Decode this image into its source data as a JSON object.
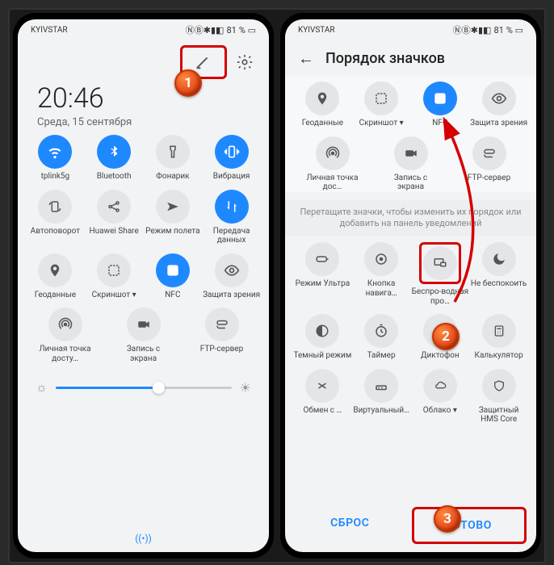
{
  "status": {
    "carrier": "KYIVSTAR",
    "battery": "81"
  },
  "left": {
    "time": "20:46",
    "date": "Среда, 15 сентября",
    "tiles": [
      [
        {
          "icon": "wifi",
          "label": "tplink5g",
          "on": true
        },
        {
          "icon": "bt",
          "label": "Bluetooth",
          "on": true
        },
        {
          "icon": "torch",
          "label": "Фонарик"
        },
        {
          "icon": "vib",
          "label": "Вибрация",
          "on": true
        }
      ],
      [
        {
          "icon": "rotate",
          "label": "Автоповорот"
        },
        {
          "icon": "share",
          "label": "Huawei Share"
        },
        {
          "icon": "plane",
          "label": "Режим полета",
          "two": true
        },
        {
          "icon": "data",
          "label": "Передача данных",
          "on": true,
          "two": true
        }
      ],
      [
        {
          "icon": "loc",
          "label": "Геоданные"
        },
        {
          "icon": "shot",
          "label": "Скриншот ▾"
        },
        {
          "icon": "nfc",
          "label": "NFC",
          "on": true
        },
        {
          "icon": "eye",
          "label": "Защита зрения",
          "two": true
        }
      ],
      [
        {
          "icon": "hotspot",
          "label": "Личная точка досту…",
          "two": true
        },
        {
          "icon": "rec",
          "label": "Запись с экрана",
          "two": true
        },
        {
          "icon": "ftp",
          "label": "FTP-сервер"
        }
      ]
    ]
  },
  "right": {
    "title": "Порядок значков",
    "hint": "Перетащите значки, чтобы изменить их порядок или добавить на панель уведомлений",
    "top": [
      [
        {
          "icon": "loc",
          "label": "Геоданные"
        },
        {
          "icon": "shot",
          "label": "Скриншот ▾"
        },
        {
          "icon": "nfc",
          "label": "NFC",
          "on": true
        },
        {
          "icon": "eye",
          "label": "Защита зрения",
          "two": true
        }
      ],
      [
        {
          "icon": "hotspot",
          "label": "Личная точка дос…",
          "two": true
        },
        {
          "icon": "rec",
          "label": "Запись с экрана",
          "two": true
        },
        {
          "icon": "ftp",
          "label": "FTP-сервер"
        }
      ]
    ],
    "bottom": [
      [
        {
          "icon": "perf",
          "label": "Режим Ультра",
          "two": true
        },
        {
          "icon": "nav",
          "label": "Кнопка навига…",
          "two": true
        },
        {
          "icon": "cast",
          "label": "Беспро-водная про…",
          "two": true,
          "box": true
        },
        {
          "icon": "dnd",
          "label": "Не беспокоить",
          "two": true
        }
      ],
      [
        {
          "icon": "dark",
          "label": "Темный режим",
          "two": true
        },
        {
          "icon": "timer",
          "label": "Таймер"
        },
        {
          "icon": "mic",
          "label": "Диктофон"
        },
        {
          "icon": "calc",
          "label": "Калькулятор"
        }
      ],
      [
        {
          "icon": "nearby",
          "label": "Обмен с …"
        },
        {
          "icon": "virt",
          "label": "Виртуальный…",
          "two": true
        },
        {
          "icon": "cloud",
          "label": "Облако ▾"
        },
        {
          "icon": "shield",
          "label": "Защитный HMS Core",
          "two": true
        }
      ]
    ],
    "reset": "СБРОС",
    "done": "ГОТОВО"
  },
  "markers": {
    "m1": "1",
    "m2": "2",
    "m3": "3"
  }
}
